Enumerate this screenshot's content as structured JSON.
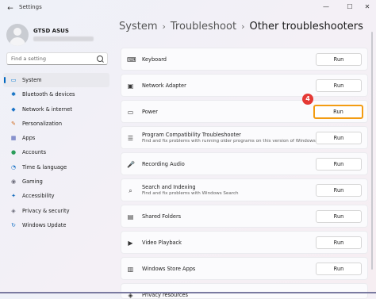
{
  "window": {
    "title": "Settings",
    "back_icon": "back-arrow-icon",
    "controls": [
      "—",
      "☐",
      "✕"
    ]
  },
  "profile": {
    "name": "GTSD ASUS"
  },
  "search": {
    "placeholder": "Find a setting"
  },
  "sidebar": {
    "items": [
      {
        "label": "System",
        "icon": "▭",
        "color": "#0078d4",
        "active": true
      },
      {
        "label": "Bluetooth & devices",
        "icon": "✱",
        "color": "#0067c0"
      },
      {
        "label": "Network & internet",
        "icon": "◆",
        "color": "#1a73c7"
      },
      {
        "label": "Personalization",
        "icon": "✎",
        "color": "#d06b1f"
      },
      {
        "label": "Apps",
        "icon": "▦",
        "color": "#4a5bb5"
      },
      {
        "label": "Accounts",
        "icon": "●",
        "color": "#2a9d5a"
      },
      {
        "label": "Time & language",
        "icon": "◔",
        "color": "#1a73c7"
      },
      {
        "label": "Gaming",
        "icon": "◉",
        "color": "#6b6b7a"
      },
      {
        "label": "Accessibility",
        "icon": "✦",
        "color": "#1a6fbf"
      },
      {
        "label": "Privacy & security",
        "icon": "◈",
        "color": "#6b6b7a"
      },
      {
        "label": "Windows Update",
        "icon": "↻",
        "color": "#1a73c7"
      }
    ]
  },
  "breadcrumb": {
    "part1": "System",
    "sep": "›",
    "part2": "Troubleshoot",
    "part3": "Other troubleshooters"
  },
  "troubleshooters": [
    {
      "title": "Keyboard",
      "icon": "⌨",
      "button": "Run"
    },
    {
      "title": "Network Adapter",
      "icon": "▣",
      "button": "Run"
    },
    {
      "title": "Power",
      "icon": "▭",
      "button": "Run",
      "highlight": true,
      "step": "4"
    },
    {
      "title": "Program Compatibility Troubleshooter",
      "desc": "Find and fix problems with running older programs on this version of Windows.",
      "icon": "☰",
      "button": "Run"
    },
    {
      "title": "Recording Audio",
      "icon": "🎤",
      "button": "Run"
    },
    {
      "title": "Search and Indexing",
      "desc": "Find and fix problems with Windows Search",
      "icon": "⌕",
      "button": "Run"
    },
    {
      "title": "Shared Folders",
      "icon": "▤",
      "button": "Run"
    },
    {
      "title": "Video Playback",
      "icon": "▶",
      "button": "Run"
    },
    {
      "title": "Windows Store Apps",
      "icon": "▥",
      "button": "Run"
    },
    {
      "title": "Privacy resources",
      "icon": "◈",
      "button": ""
    }
  ]
}
